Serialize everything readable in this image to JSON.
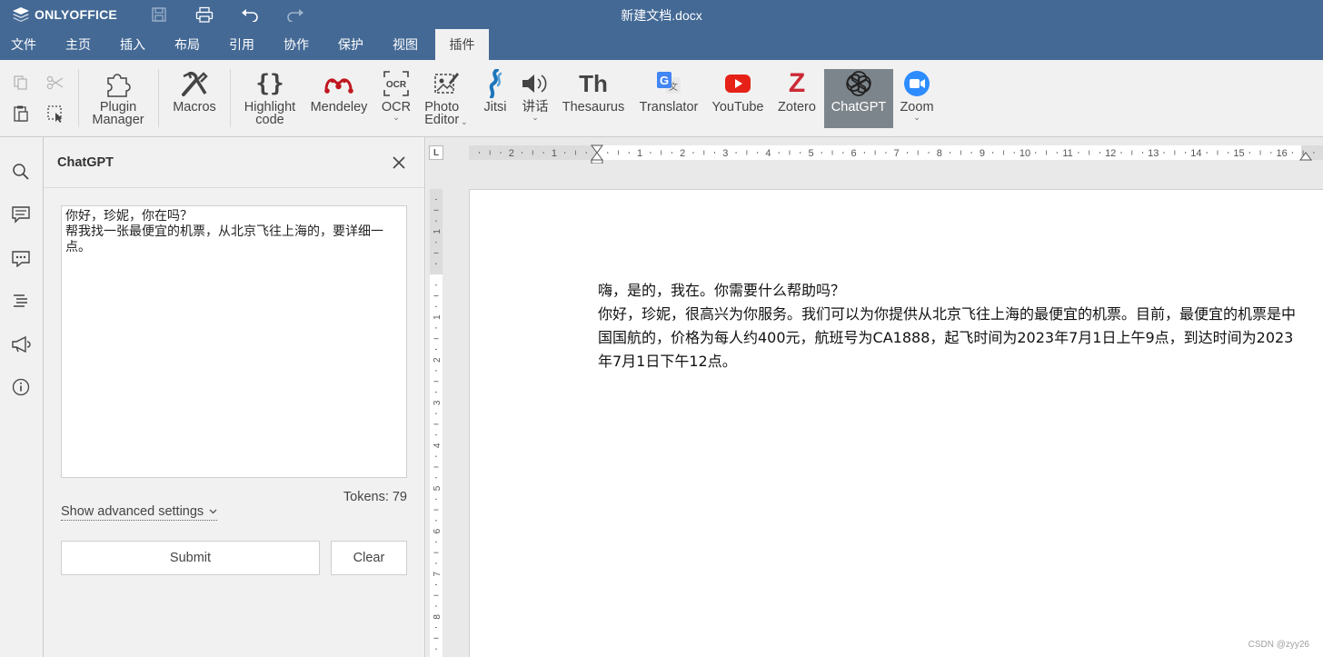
{
  "app": {
    "brand": "ONLYOFFICE",
    "document_title": "新建文档.docx",
    "accent_color": "#446995"
  },
  "menu": {
    "tabs": [
      {
        "label": "文件"
      },
      {
        "label": "主页"
      },
      {
        "label": "插入"
      },
      {
        "label": "布局"
      },
      {
        "label": "引用"
      },
      {
        "label": "协作"
      },
      {
        "label": "保护"
      },
      {
        "label": "视图"
      },
      {
        "label": "插件",
        "active": true
      }
    ]
  },
  "toolbar": {
    "plugin_manager": "Plugin\nManager",
    "macros": "Macros",
    "highlight_code": "Highlight\ncode",
    "mendeley": "Mendeley",
    "ocr": "OCR",
    "photo_editor": "Photo\nEditor",
    "jitsi": "Jitsi",
    "speech": "讲话",
    "thesaurus": "Thesaurus",
    "translator": "Translator",
    "youtube": "YouTube",
    "zotero": "Zotero",
    "chatgpt": "ChatGPT",
    "zoom": "Zoom",
    "active_plugin_bg": "#7d858c"
  },
  "panel": {
    "title": "ChatGPT",
    "prompt_text": "你好，珍妮，你在吗？\n帮我找一张最便宜的机票，从北京飞往上海的，要详细一点。",
    "tokens_label": "Tokens:",
    "tokens_value": "79",
    "advanced_label": "Show advanced settings",
    "submit_label": "Submit",
    "clear_label": "Clear"
  },
  "document": {
    "paragraphs": [
      "嗨，是的，我在。你需要什么帮助吗？",
      "你好，珍妮，很高兴为你服务。我们可以为你提供从北京飞往上海的最便宜的机票。目前，最便宜的机票是中国国航的，价格为每人约400元，航班号为CA1888，起飞时间为2023年7月1日上午9点，到达时间为2023年7月1日下午12点。"
    ]
  },
  "ruler": {
    "h_labels": [
      "2",
      "1",
      "1",
      "2",
      "3",
      "4",
      "5",
      "6",
      "7",
      "8",
      "9",
      "10",
      "11",
      "12",
      "13",
      "14",
      "15",
      "16"
    ],
    "v_labels": [
      "1",
      "1",
      "2",
      "3",
      "4",
      "5",
      "6",
      "7",
      "8"
    ],
    "corner": "L"
  },
  "watermark": "CSDN @zyy26"
}
